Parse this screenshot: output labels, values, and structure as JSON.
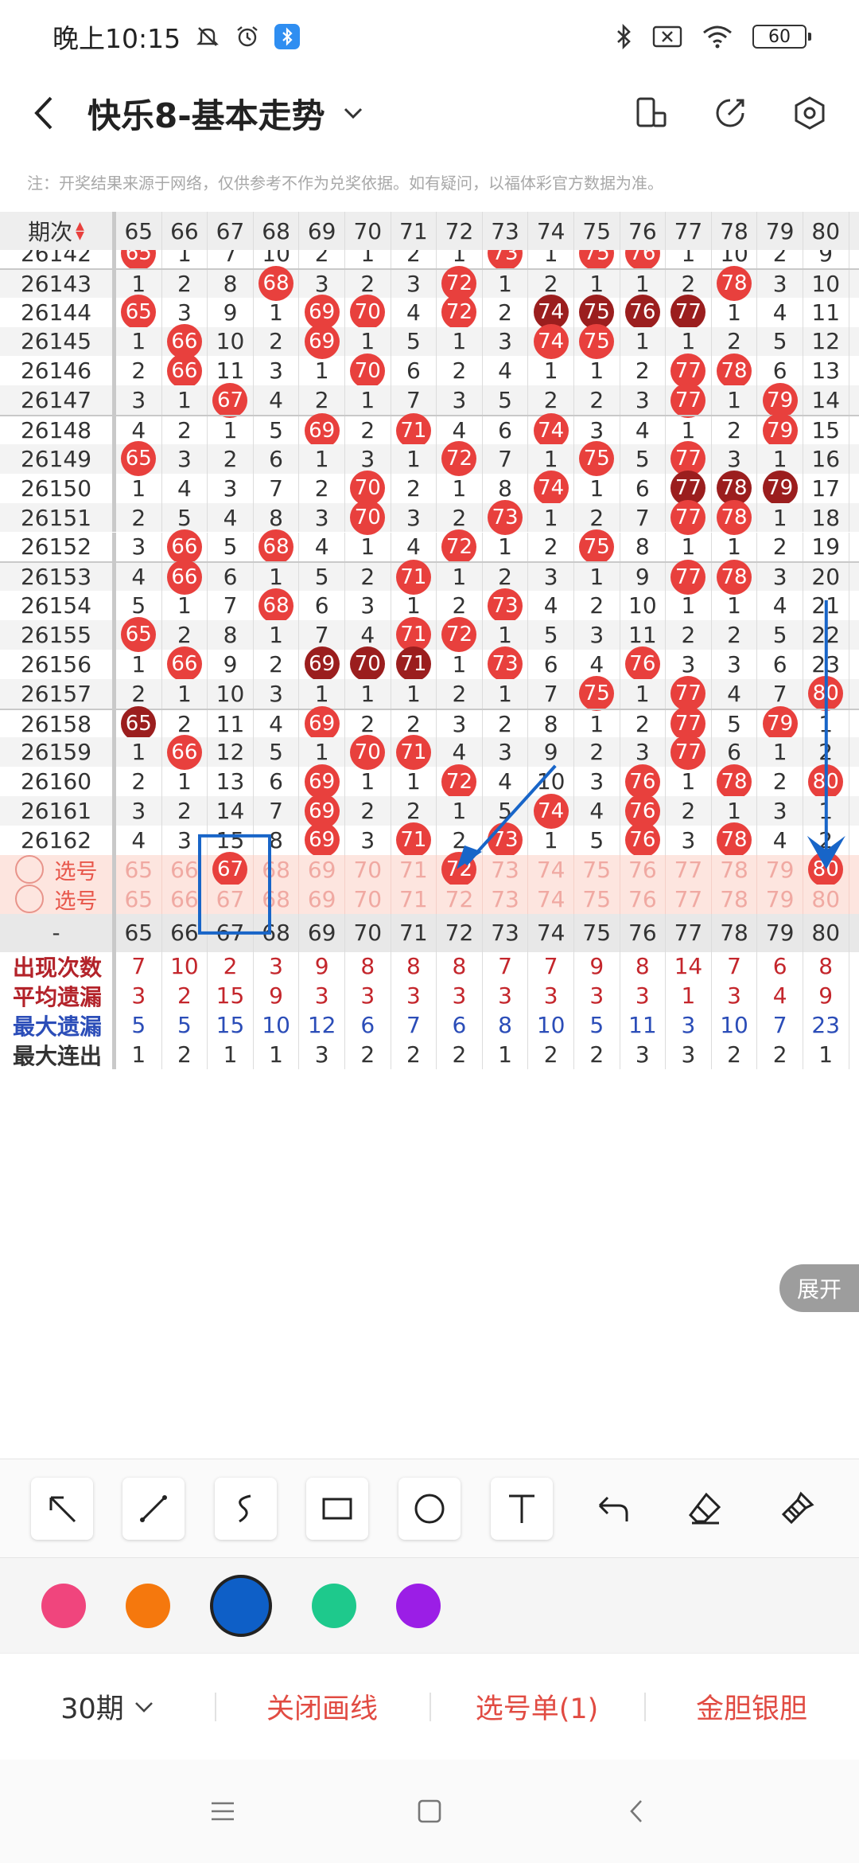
{
  "status_bar": {
    "time": "晚上10:15",
    "battery": "60",
    "icons": [
      "bell-muted-icon",
      "alarm-icon",
      "bluetooth-badge-icon",
      "bluetooth-icon",
      "sim-x-icon",
      "wifi-icon"
    ]
  },
  "header": {
    "title": "快乐8-基本走势",
    "actions": [
      "rotate-screen-icon",
      "share-icon",
      "settings-icon"
    ]
  },
  "notice": "注：开奖结果来源于网络，仅供参考不作为兑奖依据。如有疑问，以福体彩官方数据为准。",
  "table": {
    "first_header": "期次",
    "columns": [
      "65",
      "66",
      "67",
      "68",
      "69",
      "70",
      "71",
      "72",
      "73",
      "74",
      "75",
      "76",
      "77",
      "78",
      "79",
      "80"
    ],
    "rows": [
      {
        "period": "26142",
        "cells": [
          "65",
          "1",
          "7",
          "10",
          "2",
          "1",
          "2",
          "1",
          "73",
          "1",
          "75",
          "76",
          "1",
          "10",
          "2",
          "9"
        ],
        "dark": []
      },
      {
        "period": "26143",
        "cells": [
          "1",
          "2",
          "8",
          "68",
          "3",
          "2",
          "3",
          "72",
          "1",
          "2",
          "1",
          "1",
          "2",
          "78",
          "3",
          "10"
        ],
        "dark": []
      },
      {
        "period": "26144",
        "cells": [
          "65",
          "3",
          "9",
          "1",
          "69",
          "70",
          "4",
          "72",
          "2",
          "74",
          "75",
          "76",
          "77",
          "1",
          "4",
          "11"
        ],
        "dark": [
          "74",
          "75",
          "76",
          "77"
        ]
      },
      {
        "period": "26145",
        "cells": [
          "1",
          "66",
          "10",
          "2",
          "69",
          "1",
          "5",
          "1",
          "3",
          "74",
          "75",
          "1",
          "1",
          "2",
          "5",
          "12"
        ],
        "dark": []
      },
      {
        "period": "26146",
        "cells": [
          "2",
          "66",
          "11",
          "3",
          "1",
          "70",
          "6",
          "2",
          "4",
          "1",
          "1",
          "2",
          "77",
          "78",
          "6",
          "13"
        ],
        "dark": []
      },
      {
        "period": "26147",
        "cells": [
          "3",
          "1",
          "67",
          "4",
          "2",
          "1",
          "7",
          "3",
          "5",
          "2",
          "2",
          "3",
          "77",
          "1",
          "79",
          "14"
        ],
        "dark": []
      },
      {
        "period": "26148",
        "cells": [
          "4",
          "2",
          "1",
          "5",
          "69",
          "2",
          "71",
          "4",
          "6",
          "74",
          "3",
          "4",
          "1",
          "2",
          "79",
          "15"
        ],
        "dark": []
      },
      {
        "period": "26149",
        "cells": [
          "65",
          "3",
          "2",
          "6",
          "1",
          "3",
          "1",
          "72",
          "7",
          "1",
          "75",
          "5",
          "77",
          "3",
          "1",
          "16"
        ],
        "dark": []
      },
      {
        "period": "26150",
        "cells": [
          "1",
          "4",
          "3",
          "7",
          "2",
          "70",
          "2",
          "1",
          "8",
          "74",
          "1",
          "6",
          "77",
          "78",
          "79",
          "17"
        ],
        "dark": [
          "77",
          "78",
          "79"
        ]
      },
      {
        "period": "26151",
        "cells": [
          "2",
          "5",
          "4",
          "8",
          "3",
          "70",
          "3",
          "2",
          "73",
          "1",
          "2",
          "7",
          "77",
          "78",
          "1",
          "18"
        ],
        "dark": []
      },
      {
        "period": "26152",
        "cells": [
          "3",
          "66",
          "5",
          "68",
          "4",
          "1",
          "4",
          "72",
          "1",
          "2",
          "75",
          "8",
          "1",
          "1",
          "2",
          "19"
        ],
        "dark": []
      },
      {
        "period": "26153",
        "cells": [
          "4",
          "66",
          "6",
          "1",
          "5",
          "2",
          "71",
          "1",
          "2",
          "3",
          "1",
          "9",
          "77",
          "78",
          "3",
          "20"
        ],
        "dark": []
      },
      {
        "period": "26154",
        "cells": [
          "5",
          "1",
          "7",
          "68",
          "6",
          "3",
          "1",
          "2",
          "73",
          "4",
          "2",
          "10",
          "1",
          "1",
          "4",
          "21"
        ],
        "dark": []
      },
      {
        "period": "26155",
        "cells": [
          "65",
          "2",
          "8",
          "1",
          "7",
          "4",
          "71",
          "72",
          "1",
          "5",
          "3",
          "11",
          "2",
          "2",
          "5",
          "22"
        ],
        "dark": []
      },
      {
        "period": "26156",
        "cells": [
          "1",
          "66",
          "9",
          "2",
          "69",
          "70",
          "71",
          "1",
          "73",
          "6",
          "4",
          "76",
          "3",
          "3",
          "6",
          "23"
        ],
        "dark": [
          "69",
          "70",
          "71"
        ]
      },
      {
        "period": "26157",
        "cells": [
          "2",
          "1",
          "10",
          "3",
          "1",
          "1",
          "1",
          "2",
          "1",
          "7",
          "75",
          "1",
          "77",
          "4",
          "7",
          "80"
        ],
        "dark": []
      },
      {
        "period": "26158",
        "cells": [
          "65",
          "2",
          "11",
          "4",
          "69",
          "2",
          "2",
          "3",
          "2",
          "8",
          "1",
          "2",
          "77",
          "5",
          "79",
          "1"
        ],
        "dark": [
          "65"
        ]
      },
      {
        "period": "26159",
        "cells": [
          "1",
          "66",
          "12",
          "5",
          "1",
          "70",
          "71",
          "4",
          "3",
          "9",
          "2",
          "3",
          "77",
          "6",
          "1",
          "2"
        ],
        "dark": []
      },
      {
        "period": "26160",
        "cells": [
          "2",
          "1",
          "13",
          "6",
          "69",
          "1",
          "1",
          "72",
          "4",
          "10",
          "3",
          "76",
          "1",
          "78",
          "2",
          "80"
        ],
        "dark": []
      },
      {
        "period": "26161",
        "cells": [
          "3",
          "2",
          "14",
          "7",
          "69",
          "2",
          "2",
          "1",
          "5",
          "74",
          "4",
          "76",
          "2",
          "1",
          "3",
          "1"
        ],
        "dark": []
      },
      {
        "period": "26162",
        "cells": [
          "4",
          "3",
          "15",
          "8",
          "69",
          "3",
          "71",
          "2",
          "73",
          "1",
          "5",
          "76",
          "3",
          "78",
          "4",
          "2"
        ],
        "dark": []
      }
    ],
    "pick_rows": [
      {
        "label": "选号",
        "selected": [
          "67",
          "72",
          "80"
        ]
      },
      {
        "label": "选号",
        "selected": []
      }
    ],
    "summary_header_first": "-",
    "stats": [
      {
        "label": "出现次数",
        "values": [
          "7",
          "10",
          "2",
          "3",
          "9",
          "8",
          "8",
          "8",
          "7",
          "7",
          "9",
          "8",
          "14",
          "7",
          "6",
          "8"
        ]
      },
      {
        "label": "平均遗漏",
        "values": [
          "3",
          "2",
          "15",
          "9",
          "3",
          "3",
          "3",
          "3",
          "3",
          "3",
          "3",
          "3",
          "1",
          "3",
          "4",
          "9"
        ]
      },
      {
        "label": "最大遗漏",
        "values": [
          "5",
          "5",
          "15",
          "10",
          "12",
          "6",
          "7",
          "6",
          "8",
          "10",
          "5",
          "11",
          "3",
          "10",
          "7",
          "23"
        ]
      },
      {
        "label": "最大连出",
        "values": [
          "1",
          "2",
          "1",
          "1",
          "3",
          "2",
          "2",
          "2",
          "1",
          "2",
          "2",
          "3",
          "3",
          "2",
          "2",
          "1"
        ]
      }
    ],
    "expand_label": "展开"
  },
  "toolbar": {
    "tools": [
      "arrow-tool-icon",
      "line-tool-icon",
      "curve-tool-icon",
      "rectangle-tool-icon",
      "circle-tool-icon",
      "text-tool-icon",
      "undo-icon",
      "eraser-icon",
      "clear-brush-icon"
    ]
  },
  "palette": {
    "colors": [
      "#f0457d",
      "#f5780d",
      "#0e5fc7",
      "#1ec98c",
      "#9b1ee6"
    ],
    "selected": "#0e5fc7"
  },
  "actions": {
    "period": "30期",
    "close_lines": "关闭画线",
    "pick_list": "选号单(1)",
    "gold_silver": "金胆银胆"
  },
  "navbar": [
    "menu-icon",
    "home-icon",
    "back-icon"
  ]
}
